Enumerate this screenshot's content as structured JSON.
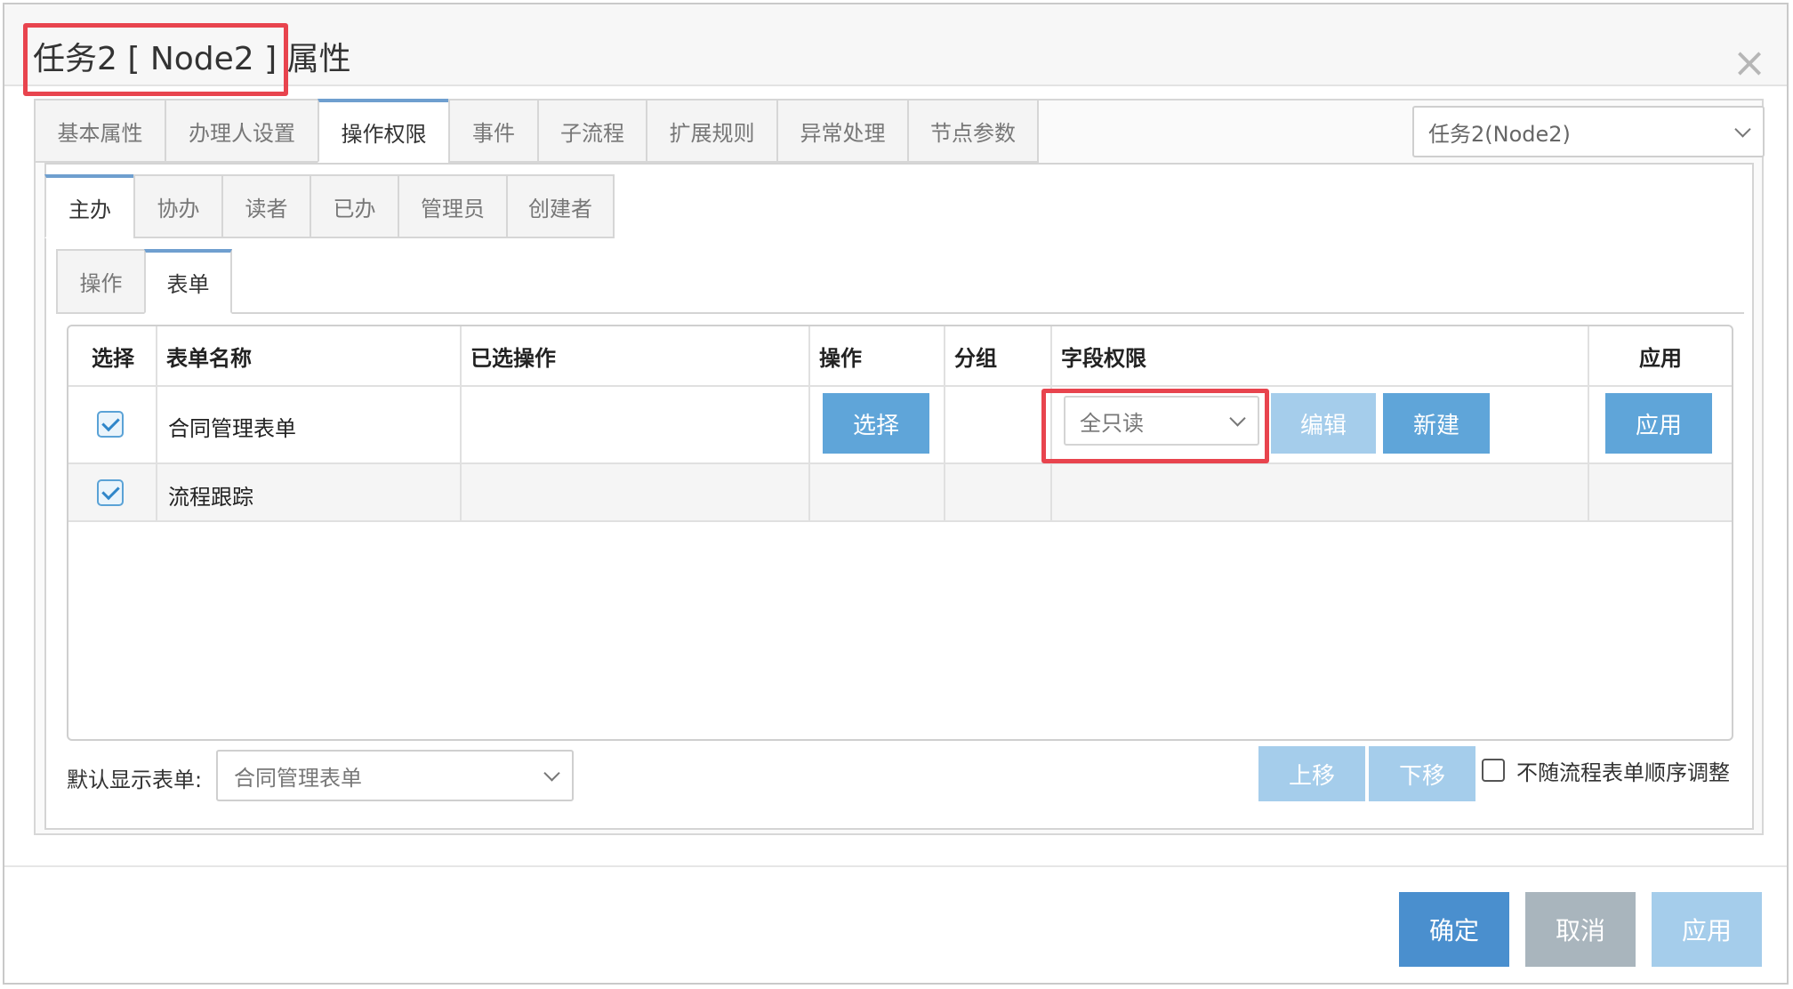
{
  "dialog": {
    "title": "任务2 [ Node2 ] 属性",
    "close_icon": "×"
  },
  "main_tabs": [
    {
      "label": "基本属性"
    },
    {
      "label": "办理人设置"
    },
    {
      "label": "操作权限",
      "active": true
    },
    {
      "label": "事件"
    },
    {
      "label": "子流程"
    },
    {
      "label": "扩展规则"
    },
    {
      "label": "异常处理"
    },
    {
      "label": "节点参数"
    }
  ],
  "node_select": {
    "value": "任务2(Node2)"
  },
  "role_tabs": [
    {
      "label": "主办",
      "active": true
    },
    {
      "label": "协办"
    },
    {
      "label": "读者"
    },
    {
      "label": "已办"
    },
    {
      "label": "管理员"
    },
    {
      "label": "创建者"
    }
  ],
  "sub_tabs": [
    {
      "label": "操作"
    },
    {
      "label": "表单",
      "active": true
    }
  ],
  "table": {
    "headers": [
      "选择",
      "表单名称",
      "已选操作",
      "操作",
      "分组",
      "字段权限",
      "应用"
    ],
    "rows": [
      {
        "checked": true,
        "name": "合同管理表单",
        "select_button": "选择",
        "field_permission": "全只读",
        "edit_button": "编辑",
        "new_button": "新建",
        "apply_button": "应用"
      },
      {
        "checked": true,
        "name": "流程跟踪"
      }
    ]
  },
  "default_form": {
    "label": "默认显示表单:",
    "value": "合同管理表单"
  },
  "order": {
    "up_button": "上移",
    "down_button": "下移",
    "keep_order_label": "不随流程表单顺序调整"
  },
  "footer": {
    "ok": "确定",
    "cancel": "取消",
    "apply": "应用"
  },
  "colors": {
    "highlight": "#e8444e",
    "primary": "#4a8fce",
    "button_blue": "#5fa5d9",
    "button_light": "#a5cdeb",
    "cancel_gray": "#a9b5bd"
  }
}
